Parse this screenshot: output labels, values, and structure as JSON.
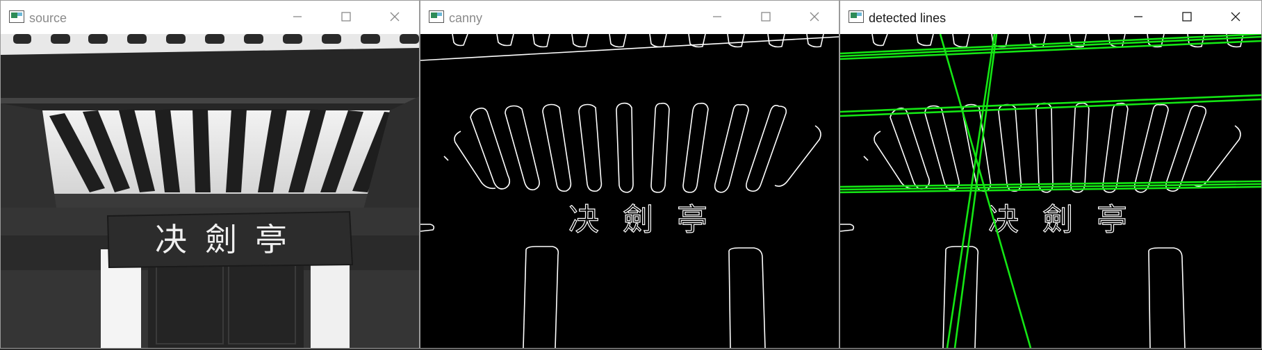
{
  "windows": [
    {
      "title": "source",
      "state": "inactive",
      "content": "grayscale-photo"
    },
    {
      "title": "canny",
      "state": "inactive",
      "content": "edge-map"
    },
    {
      "title": "detected lines",
      "state": "active",
      "content": "edge-map-with-lines"
    }
  ],
  "sign": {
    "characters": "决劍亭"
  },
  "colors": {
    "line_color": "#14e614",
    "edge_color": "#ffffff",
    "background": "#000000"
  },
  "icons": {
    "app": "opencv-window-icon",
    "minimize": "minimize-icon",
    "maximize": "maximize-icon",
    "close": "close-icon"
  }
}
